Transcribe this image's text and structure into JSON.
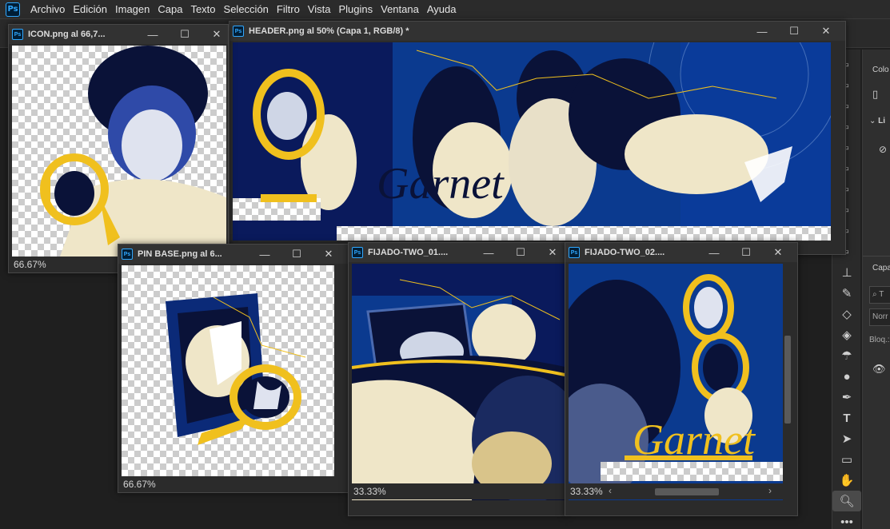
{
  "menu": {
    "logo": "Ps",
    "items": [
      "Archivo",
      "Edición",
      "Imagen",
      "Capa",
      "Texto",
      "Selección",
      "Filtro",
      "Vista",
      "Plugins",
      "Ventana",
      "Ayuda"
    ]
  },
  "windows": {
    "icon": {
      "title": "ICON.png al 66,7...",
      "zoom": "66.67%"
    },
    "header": {
      "title": "HEADER.png al 50% (Capa 1, RGB/8) *"
    },
    "pin": {
      "title": "PIN BASE.png al 6...",
      "zoom": "66.67%"
    },
    "fijado1": {
      "title": "FIJADO-TWO_01....",
      "zoom": "33.33%"
    },
    "fijado2": {
      "title": "FIJADO-TWO_02....",
      "zoom": "33.33%"
    }
  },
  "artwork": {
    "text": "Garnet"
  },
  "window_controls": {
    "minimize": "—",
    "maximize": "☐",
    "close": "✕"
  },
  "panels": {
    "color": "Colo",
    "libraries": "Li",
    "layers": "Capa",
    "search": "T",
    "blend": "Norr",
    "lock": "Bloq.:"
  },
  "icons": {
    "doc_ps": "Ps"
  },
  "colors": {
    "accent": "#31a8ff",
    "art_blue": "#0b3a8f",
    "art_navy": "#0a1238",
    "art_yellow": "#f0c01e",
    "art_cream": "#efe6c8"
  }
}
